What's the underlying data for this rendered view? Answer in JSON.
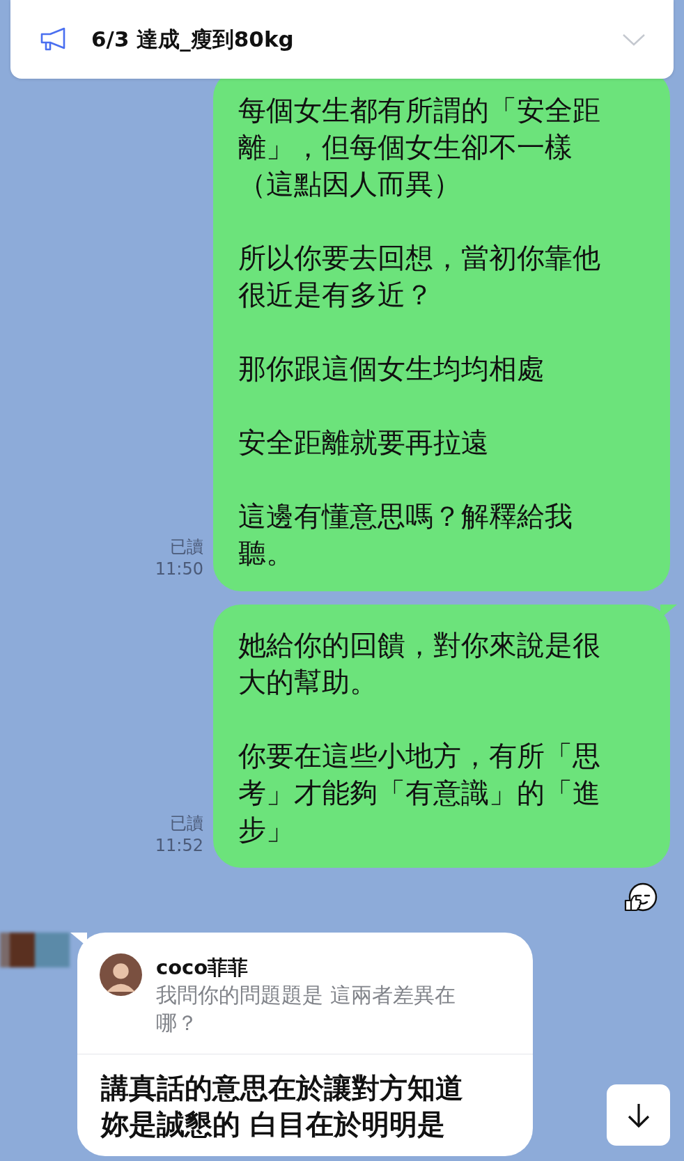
{
  "announcement": {
    "text": "6/3 達成_瘦到80kg"
  },
  "messages": [
    {
      "kind": "sent",
      "read_label": "已讀",
      "time": "11:50",
      "paragraphs": [
        "每個女生都有所謂的「安全距離」，但每個女生卻不一樣（這點因人而異）",
        "所以你要去回想，當初你靠他很近是有多近？",
        "那你跟這個女生均均相處",
        "安全距離就要再拉遠",
        "這邊有懂意思嗎？解釋給我聽。"
      ]
    },
    {
      "kind": "sent",
      "read_label": "已讀",
      "time": "11:52",
      "tail": true,
      "paragraphs": [
        "她給你的回饋，對你來說是很大的幫助。",
        "你要在這些小地方，有所「思考」才能夠「有意識」的「進步」"
      ]
    },
    {
      "kind": "received",
      "tail": true,
      "reply_to": {
        "name": "coco菲菲",
        "text": "我問你的問題題是 這兩者差異在哪？"
      },
      "paragraphs": [
        "講真話的意思在於讓對方知道妳是誠懇的 白目在於明明是"
      ]
    }
  ]
}
